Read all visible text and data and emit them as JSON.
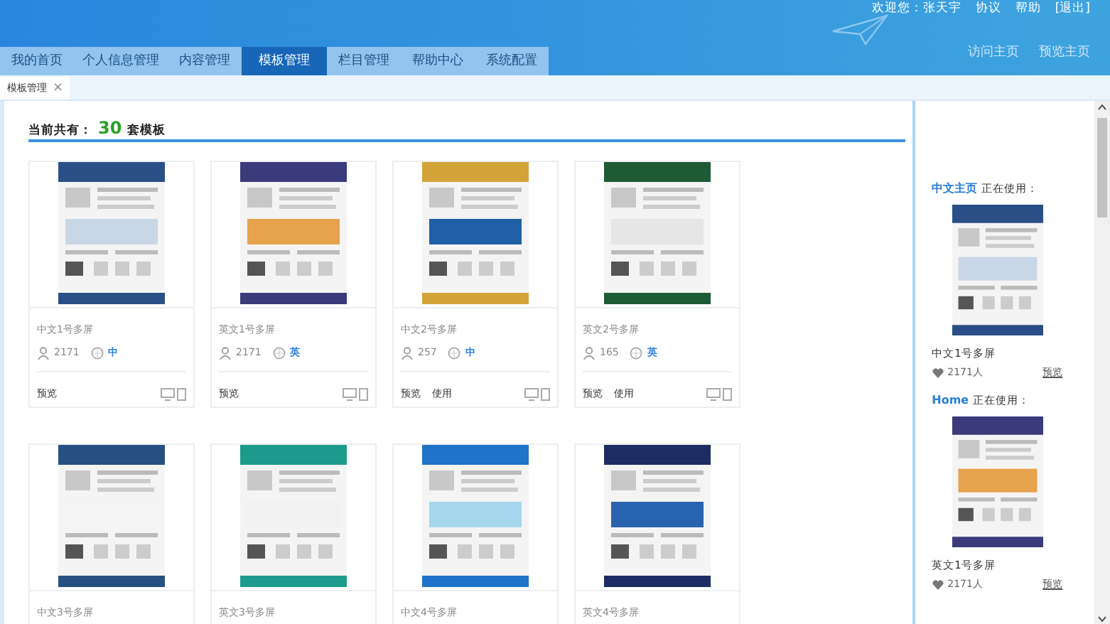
{
  "header": {
    "welcome": "欢迎您：张天宇",
    "links": [
      "协议",
      "帮助",
      "[退出]"
    ],
    "site_links": [
      "访问主页",
      "预览主页"
    ]
  },
  "nav": [
    {
      "label": "我的首页",
      "selected": false
    },
    {
      "label": "个人信息管理",
      "selected": false
    },
    {
      "label": "内容管理",
      "selected": false
    },
    {
      "label": "模板管理",
      "selected": true
    },
    {
      "label": "栏目管理",
      "selected": false
    },
    {
      "label": "帮助中心",
      "selected": false
    },
    {
      "label": "系统配置",
      "selected": false
    }
  ],
  "page_tabs": [
    {
      "label": "模板管理",
      "close": "×",
      "selected": true
    }
  ],
  "summary": {
    "label": "当前共有：",
    "count": "30",
    "unit": "套模板"
  },
  "templates": [
    {
      "name": "中文1号多屏",
      "kind": "blue",
      "users": "2171",
      "lang": "中",
      "actions": [
        "预览"
      ]
    },
    {
      "name": "英文1号多屏",
      "kind": "purple",
      "users": "2171",
      "lang": "英",
      "actions": [
        "预览"
      ]
    },
    {
      "name": "中文2号多屏",
      "kind": "gold",
      "users": "257",
      "lang": "中",
      "actions": [
        "预览",
        "使用"
      ]
    },
    {
      "name": "英文2号多屏",
      "kind": "green",
      "users": "165",
      "lang": "英",
      "actions": [
        "预览",
        "使用"
      ]
    },
    {
      "name": "中文3号多屏",
      "kind": "navy"
    },
    {
      "name": "英文3号多屏",
      "kind": "teal"
    },
    {
      "name": "中文4号多屏",
      "kind": "sky"
    },
    {
      "name": "英文4号多屏",
      "kind": "night"
    }
  ],
  "in_use": [
    {
      "site": "中文主页",
      "status": "正在使用：",
      "kind": "blue",
      "template": "中文1号多屏",
      "likes": "2171人",
      "action": "预览"
    },
    {
      "site": "Home",
      "status": "正在使用：",
      "kind": "purple",
      "template": "英文1号多屏",
      "likes": "2171人",
      "action": "预览"
    }
  ]
}
